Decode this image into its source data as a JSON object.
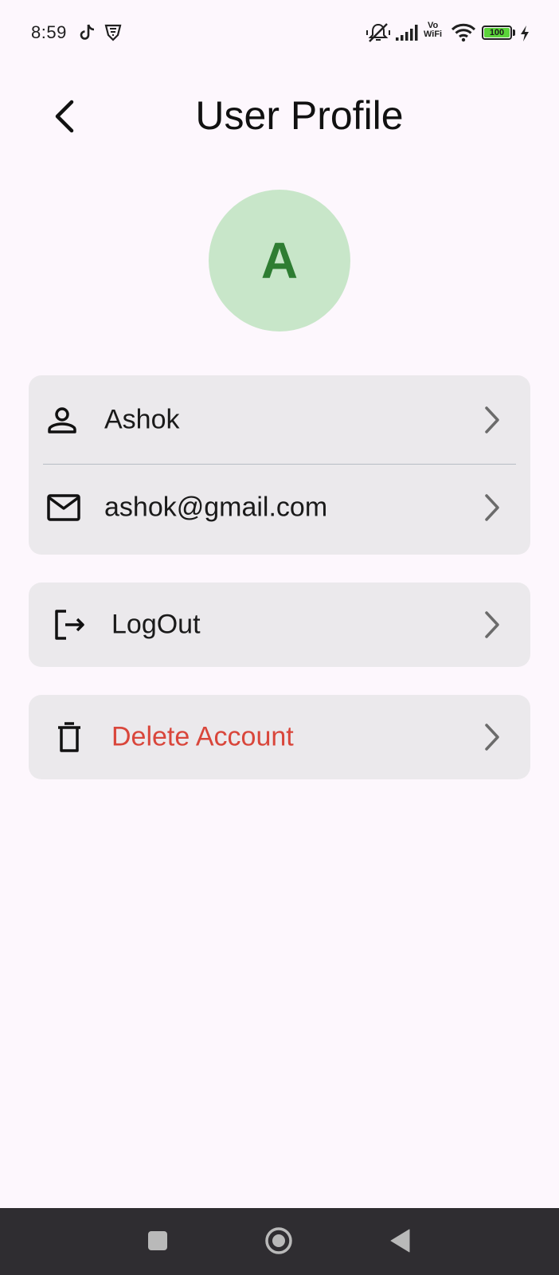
{
  "status_bar": {
    "time": "8:59",
    "network_label_top": "Vo",
    "network_label_bottom": "WiFi",
    "battery_level": "100",
    "icons": [
      "tiktok-icon",
      "vpn-shield-icon",
      "mute-icon",
      "signal-icon",
      "wifi-icon",
      "battery-icon",
      "charging-icon"
    ]
  },
  "header": {
    "title": "User Profile",
    "back_icon": "chevron-left-icon"
  },
  "avatar": {
    "initial": "A",
    "background": "#c8e6c9",
    "color": "#2e7d32"
  },
  "profile_card": {
    "name": "Ashok",
    "name_icon": "person-icon",
    "email": "ashok@gmail.com",
    "email_icon": "mail-icon"
  },
  "actions": {
    "logout_label": "LogOut",
    "logout_icon": "logout-icon",
    "delete_label": "Delete Account",
    "delete_icon": "trash-icon",
    "delete_color": "#d9463b"
  },
  "nav_bar": {
    "icons": [
      "recents-square-icon",
      "home-circle-icon",
      "back-triangle-icon"
    ]
  }
}
